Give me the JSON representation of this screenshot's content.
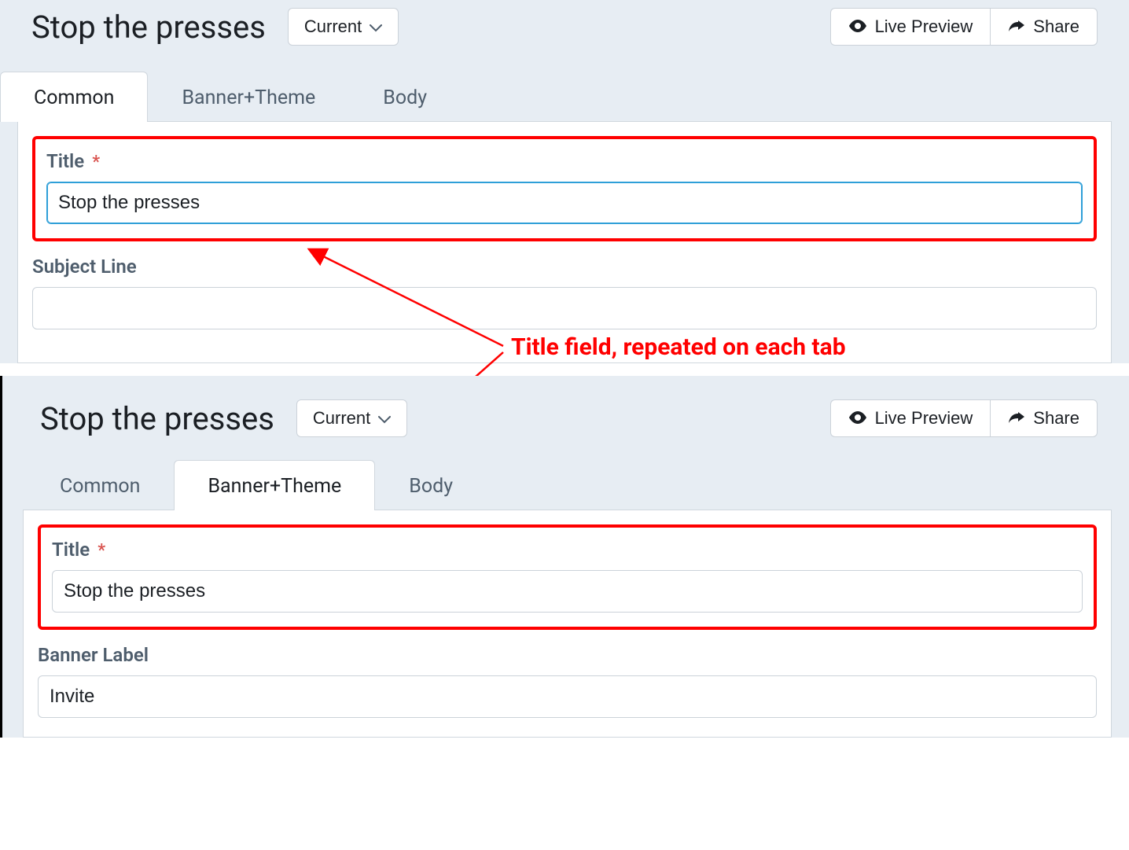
{
  "annotation": {
    "text": "Title field, repeated on each tab"
  },
  "top": {
    "page_title": "Stop the presses",
    "version_btn": "Current",
    "live_preview_btn": "Live Preview",
    "share_btn": "Share",
    "tabs": [
      {
        "label": "Common",
        "active": true
      },
      {
        "label": "Banner+Theme",
        "active": false
      },
      {
        "label": "Body",
        "active": false
      }
    ],
    "fields": {
      "title_label": "Title",
      "title_value": "Stop the presses",
      "subject_label": "Subject Line",
      "subject_value": ""
    }
  },
  "bottom": {
    "page_title": "Stop the presses",
    "version_btn": "Current",
    "live_preview_btn": "Live Preview",
    "share_btn": "Share",
    "tabs": [
      {
        "label": "Common",
        "active": false
      },
      {
        "label": "Banner+Theme",
        "active": true
      },
      {
        "label": "Body",
        "active": false
      }
    ],
    "fields": {
      "title_label": "Title",
      "title_value": "Stop the presses",
      "banner_label_label": "Banner Label",
      "banner_label_value": "Invite"
    }
  },
  "required_mark": "*"
}
